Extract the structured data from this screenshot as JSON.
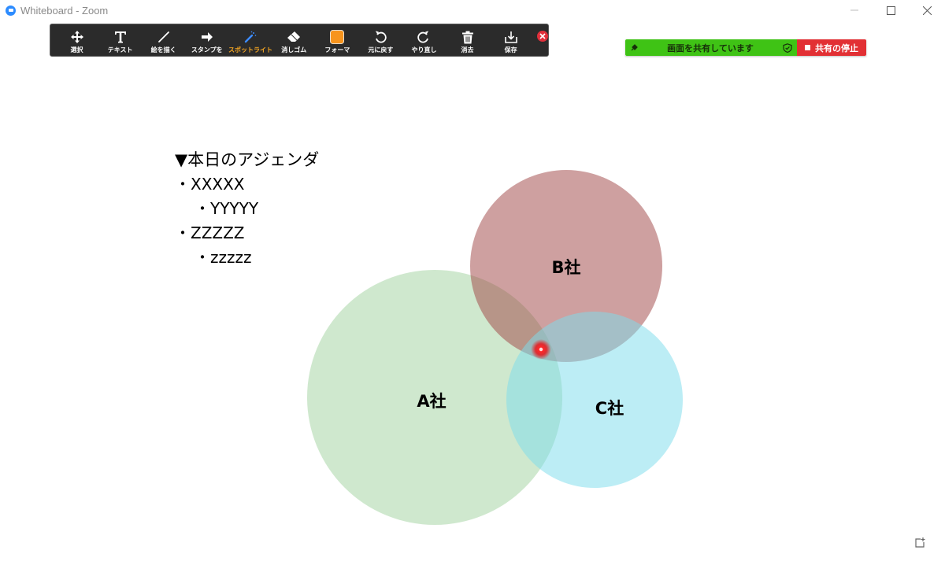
{
  "window": {
    "title": "Whiteboard - Zoom"
  },
  "toolbar": {
    "tools": [
      {
        "label": "選択",
        "icon": "move-icon"
      },
      {
        "label": "テキスト",
        "icon": "text-icon"
      },
      {
        "label": "絵を描く",
        "icon": "draw-line-icon"
      },
      {
        "label": "スタンプを",
        "icon": "arrow-stamp-icon"
      },
      {
        "label": "スポットライト",
        "icon": "spotlight-wand-icon",
        "active": true
      },
      {
        "label": "消しゴム",
        "icon": "eraser-icon"
      },
      {
        "label": "フォーマ",
        "icon": "format-color-icon"
      },
      {
        "label": "元に戻す",
        "icon": "undo-icon"
      },
      {
        "label": "やり直し",
        "icon": "redo-icon"
      },
      {
        "label": "消去",
        "icon": "trash-icon"
      },
      {
        "label": "保存",
        "icon": "save-icon"
      }
    ],
    "active_color": "#f5a623",
    "format_color": "#f7941d"
  },
  "share": {
    "status_text": "画面を共有しています",
    "stop_label": "共有の停止",
    "status_color": "#3fc315",
    "stop_color": "#e23034"
  },
  "agenda": {
    "heading": "▼本日のアジェンダ",
    "items": [
      {
        "text": "・XXXXX",
        "level": 0
      },
      {
        "text": "・YYYYY",
        "level": 1
      },
      {
        "text": "・ZZZZZ",
        "level": 0
      },
      {
        "text": "・zzzzz",
        "level": 1
      }
    ]
  },
  "diagram": {
    "circles": [
      {
        "label": "A社",
        "color": "#a8d5a6"
      },
      {
        "label": "B社",
        "color": "#a24848"
      },
      {
        "label": "C社",
        "color": "#7fdcec"
      }
    ],
    "pointer_color": "#e8161b"
  }
}
